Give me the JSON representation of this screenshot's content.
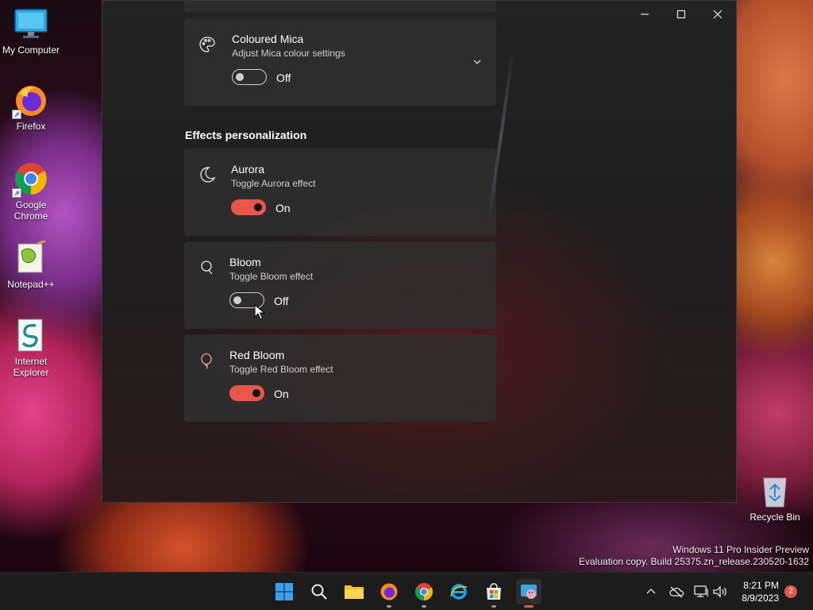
{
  "desktop": {
    "icons": [
      {
        "label_line1": "My Computer",
        "label_line2": "",
        "icon": "monitor-icon"
      },
      {
        "label_line1": "Firefox",
        "label_line2": "",
        "icon": "firefox-icon"
      },
      {
        "label_line1": "Google",
        "label_line2": "Chrome",
        "icon": "chrome-icon"
      },
      {
        "label_line1": "Notepad++",
        "label_line2": "",
        "icon": "notepadpp-icon"
      },
      {
        "label_line1": "Internet",
        "label_line2": "Explorer",
        "icon": "ie-icon"
      },
      {
        "label_line1": "Recycle Bin",
        "label_line2": "",
        "icon": "recycle-bin-icon"
      }
    ],
    "watermark": {
      "line1": "Windows 11 Pro Insider Preview",
      "line2": "Evaluation copy. Build 25375.zn_release.230520-1632"
    }
  },
  "window": {
    "cards": [
      {
        "title": "Coloured Mica",
        "subtitle": "Adjust Mica colour settings",
        "state_label": "Off",
        "on": false,
        "icon": "palette-icon",
        "expandable": true
      },
      {
        "title": "Aurora",
        "subtitle": "Toggle Aurora effect",
        "state_label": "On",
        "on": true,
        "icon": "moon-icon"
      },
      {
        "title": "Bloom",
        "subtitle": "Toggle Bloom effect",
        "state_label": "Off",
        "on": false,
        "icon": "bulb-icon"
      },
      {
        "title": "Red Bloom",
        "subtitle": "Toggle Red Bloom effect",
        "state_label": "On",
        "on": true,
        "icon": "balloon-icon"
      }
    ],
    "section_heading": "Effects personalization"
  },
  "taskbar": {
    "apps": [
      "start-icon",
      "search-icon",
      "file-explorer-icon",
      "firefox-icon",
      "chrome-icon",
      "edge-ie-icon",
      "store-icon",
      "settings-app-icon"
    ],
    "tray": {
      "time": "8:21 PM",
      "date": "8/9/2023",
      "notification_count": "2"
    }
  },
  "colors": {
    "accent": "#e9564a",
    "card_bg": "#303030",
    "taskbar_bg": "#1c1c1c"
  }
}
